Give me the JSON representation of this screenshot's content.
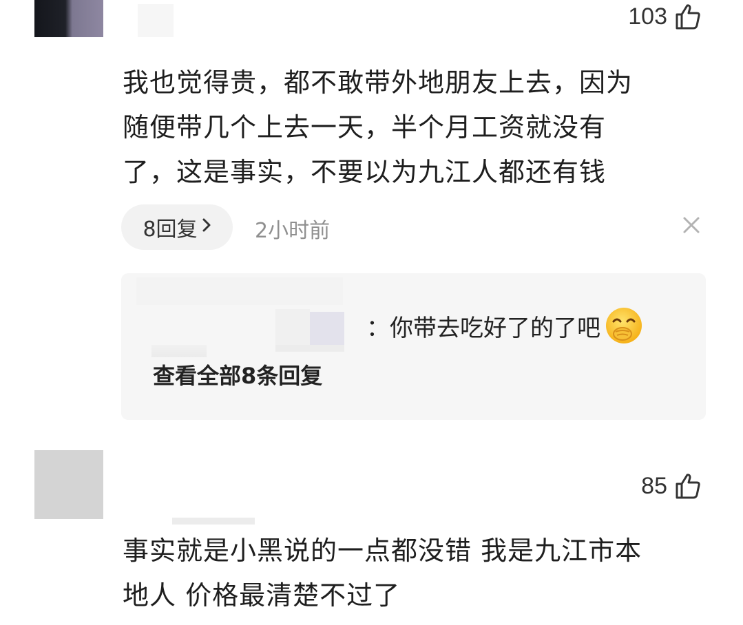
{
  "comments": [
    {
      "likes": "103",
      "lines": [
        "我也觉得贵，都不敢带外地朋友上去，因为",
        "随便带几个上去一天，半个月工资就没有",
        "了，这是事实，不要以为九江人都还有钱"
      ],
      "reply_count_label": "8回复",
      "time": "2小时前",
      "reply_preview": {
        "text": "：你带去吃好了的了吧",
        "emoji": "smiling-face-with-hand-over-mouth",
        "view_all_label": "查看全部8条回复"
      }
    },
    {
      "likes": "85",
      "lines": [
        "事实就是小黑说的一点都没错 我是九江市本",
        "地人 价格最清楚不过了"
      ]
    }
  ],
  "icons": {
    "like": "thumbs-up-outline-icon",
    "close": "close-icon",
    "chevron": "chevron-right-icon"
  },
  "colors": {
    "text": "#1e1e1e",
    "secondary": "#8f8f8f",
    "pill_bg": "#f2f2f2",
    "reply_bg": "#f6f6f6"
  }
}
